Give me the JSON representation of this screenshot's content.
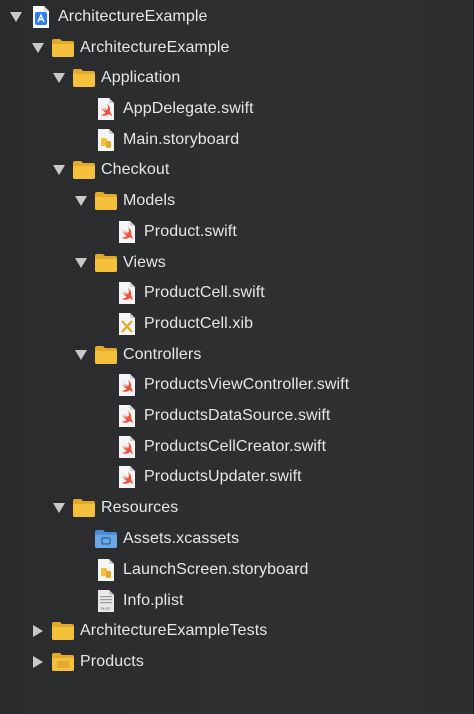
{
  "navigator": {
    "items": [
      {
        "label": "ArchitectureExample",
        "icon": "xcode-project-icon",
        "disclosure": "expanded"
      },
      {
        "label": "ArchitectureExample",
        "icon": "folder-icon",
        "disclosure": "expanded"
      },
      {
        "label": "Application",
        "icon": "folder-icon",
        "disclosure": "expanded"
      },
      {
        "label": "AppDelegate.swift",
        "icon": "swift-file-icon",
        "disclosure": "none"
      },
      {
        "label": "Main.storyboard",
        "icon": "storyboard-file-icon",
        "disclosure": "none"
      },
      {
        "label": "Checkout",
        "icon": "folder-icon",
        "disclosure": "expanded"
      },
      {
        "label": "Models",
        "icon": "folder-icon",
        "disclosure": "expanded"
      },
      {
        "label": "Product.swift",
        "icon": "swift-file-icon",
        "disclosure": "none"
      },
      {
        "label": "Views",
        "icon": "folder-icon",
        "disclosure": "expanded"
      },
      {
        "label": "ProductCell.swift",
        "icon": "swift-file-icon",
        "disclosure": "none"
      },
      {
        "label": "ProductCell.xib",
        "icon": "xib-file-icon",
        "disclosure": "none"
      },
      {
        "label": "Controllers",
        "icon": "folder-icon",
        "disclosure": "expanded"
      },
      {
        "label": "ProductsViewController.swift",
        "icon": "swift-file-icon",
        "disclosure": "none"
      },
      {
        "label": "ProductsDataSource.swift",
        "icon": "swift-file-icon",
        "disclosure": "none"
      },
      {
        "label": "ProductsCellCreator.swift",
        "icon": "swift-file-icon",
        "disclosure": "none"
      },
      {
        "label": "ProductsUpdater.swift",
        "icon": "swift-file-icon",
        "disclosure": "none"
      },
      {
        "label": "Resources",
        "icon": "folder-icon",
        "disclosure": "expanded"
      },
      {
        "label": "Assets.xcassets",
        "icon": "asset-catalog-icon",
        "disclosure": "none"
      },
      {
        "label": "LaunchScreen.storyboard",
        "icon": "storyboard-file-icon",
        "disclosure": "none"
      },
      {
        "label": "Info.plist",
        "icon": "plist-file-icon",
        "disclosure": "none"
      },
      {
        "label": "ArchitectureExampleTests",
        "icon": "folder-icon",
        "disclosure": "collapsed"
      },
      {
        "label": "Products",
        "icon": "products-folder-icon",
        "disclosure": "collapsed"
      }
    ],
    "plist_badge": "PLIST"
  },
  "colors": {
    "background": "#2b2c2e",
    "text": "#e6e6e6",
    "folder": "#f5c13d",
    "swift": "#f05138",
    "xcode_blue": "#2f7ff0",
    "asset_blue": "#6aa9e5"
  }
}
